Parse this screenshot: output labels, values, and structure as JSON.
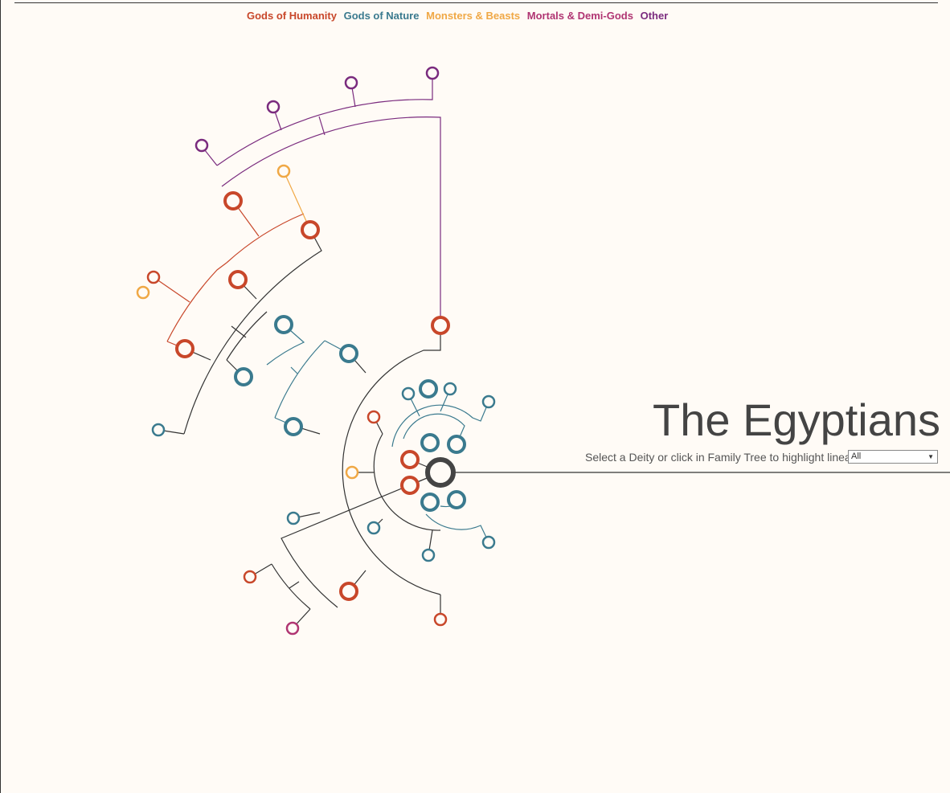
{
  "legend": {
    "humanity": {
      "label": "Gods of Humanity",
      "color": "#c8472a"
    },
    "nature": {
      "label": "Gods of Nature",
      "color": "#3a7a8e"
    },
    "monsters": {
      "label": "Monsters & Beasts",
      "color": "#f0a845"
    },
    "mortals": {
      "label": "Mortals & Demi-Gods",
      "color": "#b03572"
    },
    "other": {
      "label": "Other",
      "color": "#7a2b7e"
    }
  },
  "title": "The Egyptians",
  "subtitle": "Select a Deity or click in Family Tree to highlight lineage",
  "deity_select": {
    "value": "All"
  },
  "tree": {
    "root_color": "#444444",
    "line_color": "#333333"
  }
}
